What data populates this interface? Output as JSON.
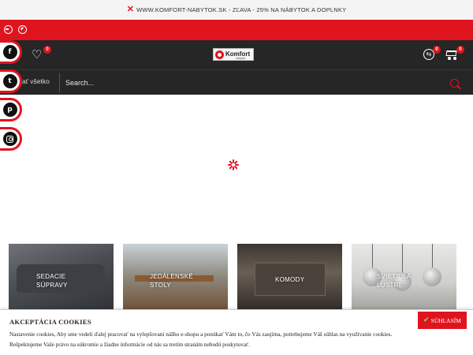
{
  "promo": {
    "text": "WWW.KOMFORT-NABYTOK.SK - ZĽAVA - 25% NA NÁBYTOK A DOPLNKY",
    "close_glyph": "✕"
  },
  "header": {
    "wishlist_count": "0",
    "logo_text": "Komfort",
    "logo_subtext": "nábytok",
    "compare_count": "0",
    "cart_count": "0"
  },
  "search": {
    "categories_label": "ať všetko",
    "placeholder": "Search..."
  },
  "social": [
    {
      "name": "facebook",
      "glyph": "f"
    },
    {
      "name": "twitter",
      "glyph": "t"
    },
    {
      "name": "pinterest",
      "glyph": "p"
    },
    {
      "name": "instagram",
      "glyph": ""
    }
  ],
  "categories": [
    {
      "line1": "SEDACIE",
      "line2": "SÚPRAVY"
    },
    {
      "line1": "JEDÁLENSKÉ",
      "line2": "STOLY"
    },
    {
      "line1": "KOMODY",
      "line2": ""
    },
    {
      "line1": "SVIETIDLÁ",
      "line2": "LUSTRE"
    }
  ],
  "cookie": {
    "title": "AKCEPTÁCIA COOKIES",
    "line1": "Nastavenie cookies, Aby sme vedeli ďalej pracovať na vylepšovaní nášho e-shopu a ponúkať Vám to, čo Vás zaujíma, potrebujeme Váš súhlas na využívanie cookies.",
    "line2": "Rešpektujeme Vaše právo na súkromie a žiadne informácie od nás sa tretím stranám nebudú poskytovať.",
    "agree_label": "SÚHLASÍM",
    "agree_glyph": "✔"
  },
  "colors": {
    "accent": "#e0141e",
    "header_bg": "#262626",
    "promo_bg": "#f4f4f4"
  }
}
